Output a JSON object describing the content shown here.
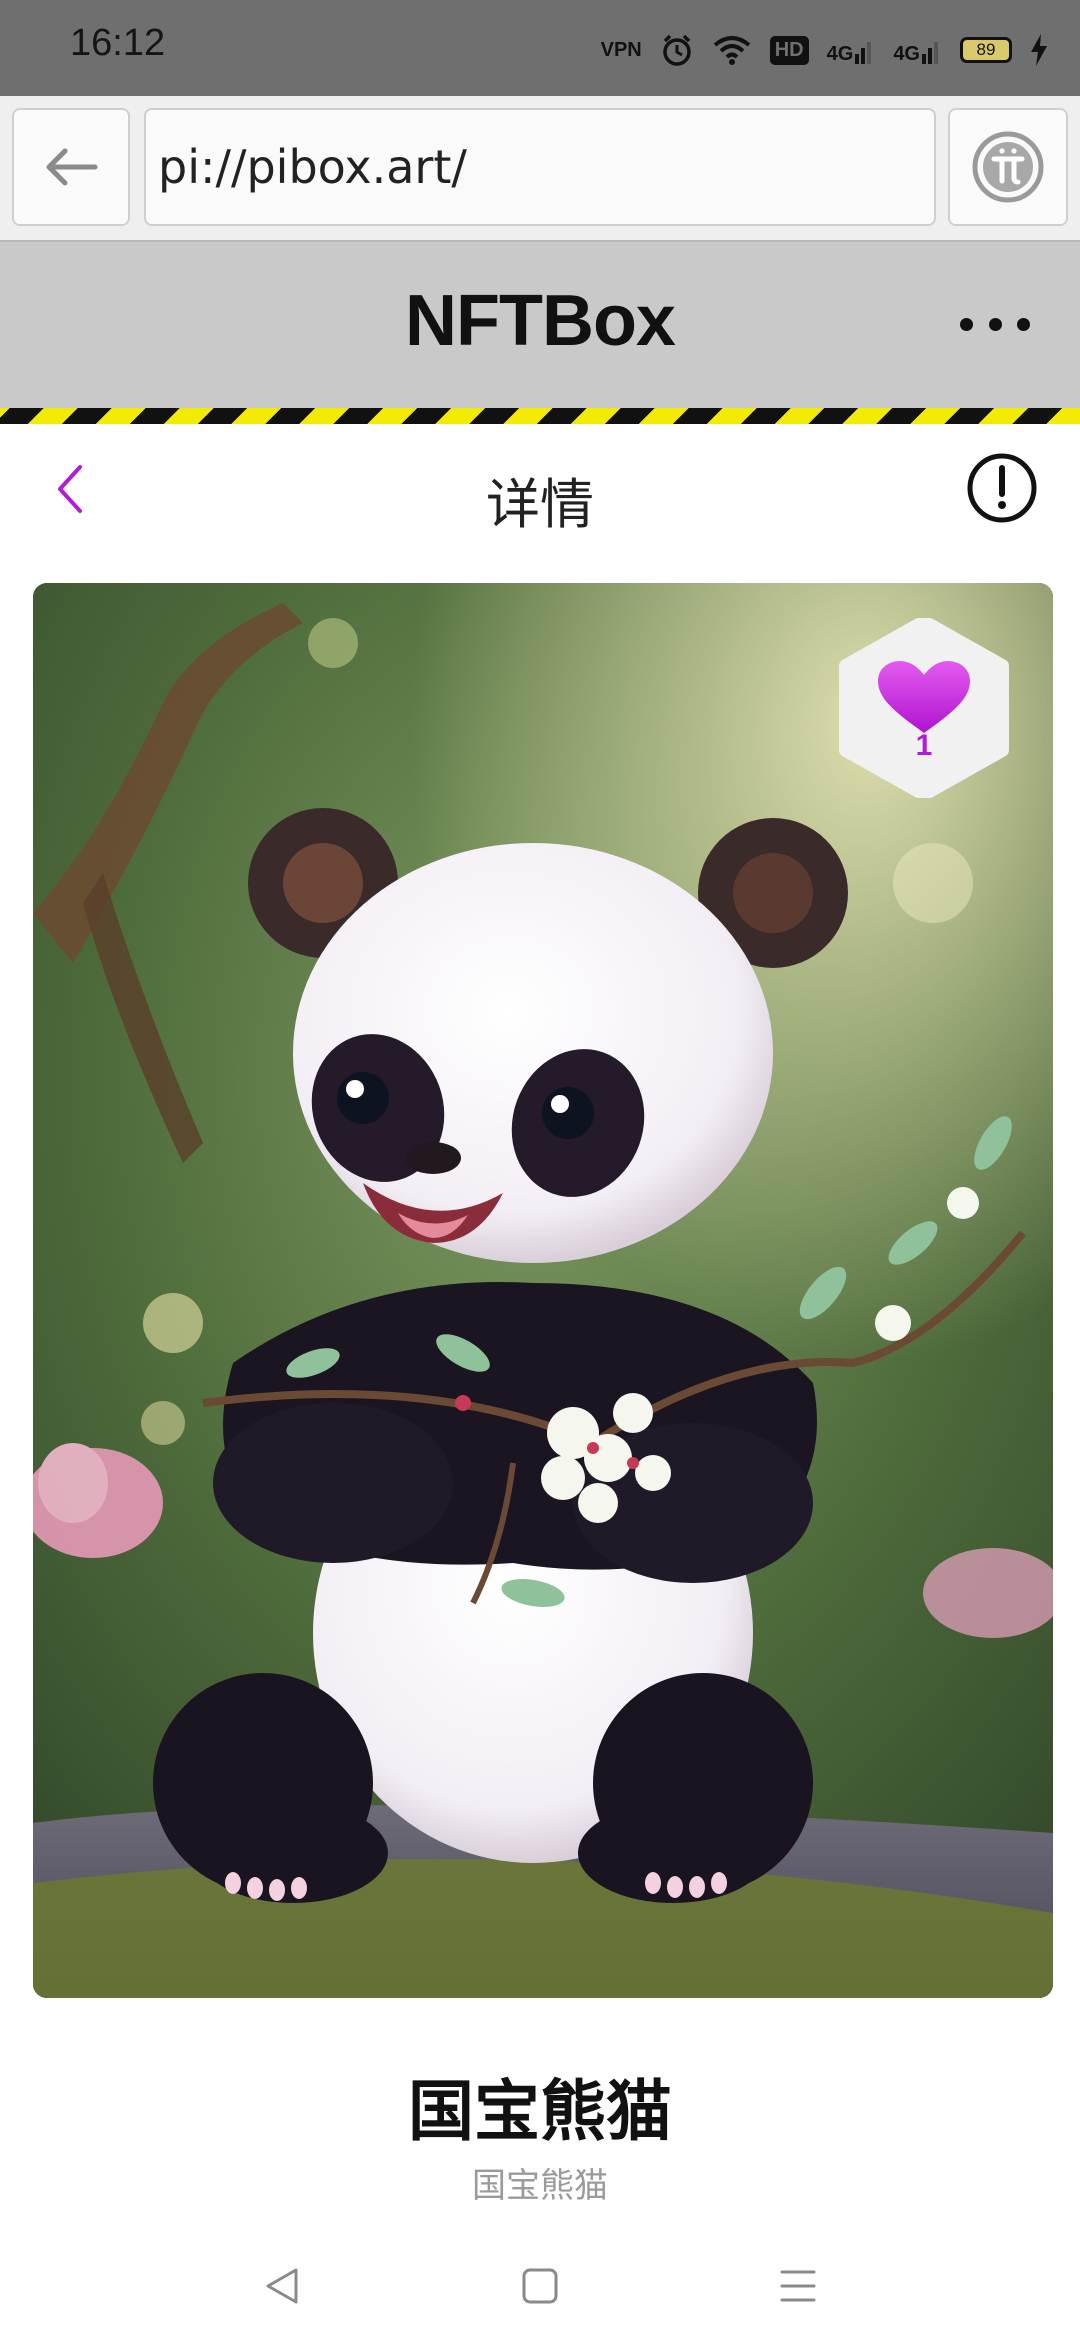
{
  "status_bar": {
    "time": "16:12",
    "vpn_label": "VPN",
    "hd_label": "HD",
    "network_1": "4G",
    "network_2": "4G",
    "battery": "89"
  },
  "browser": {
    "url": "pi://pibox.art/"
  },
  "app_header": {
    "title": "NFTBox"
  },
  "page_nav": {
    "title": "详情"
  },
  "artwork": {
    "like_count": "1",
    "like_color": "#c52ee0"
  },
  "nft": {
    "title": "国宝熊猫",
    "subtitle": "国宝熊猫"
  },
  "icons": {
    "browser_back": "arrow-left-icon",
    "pi_logo": "pi-logo-icon",
    "more": "more-dots-icon",
    "nav_back": "chevron-left-icon",
    "info": "info-exclamation-icon",
    "like": "heart-icon",
    "sys_back": "triangle-back-icon",
    "sys_home": "square-home-icon",
    "sys_menu": "menu-lines-icon"
  }
}
